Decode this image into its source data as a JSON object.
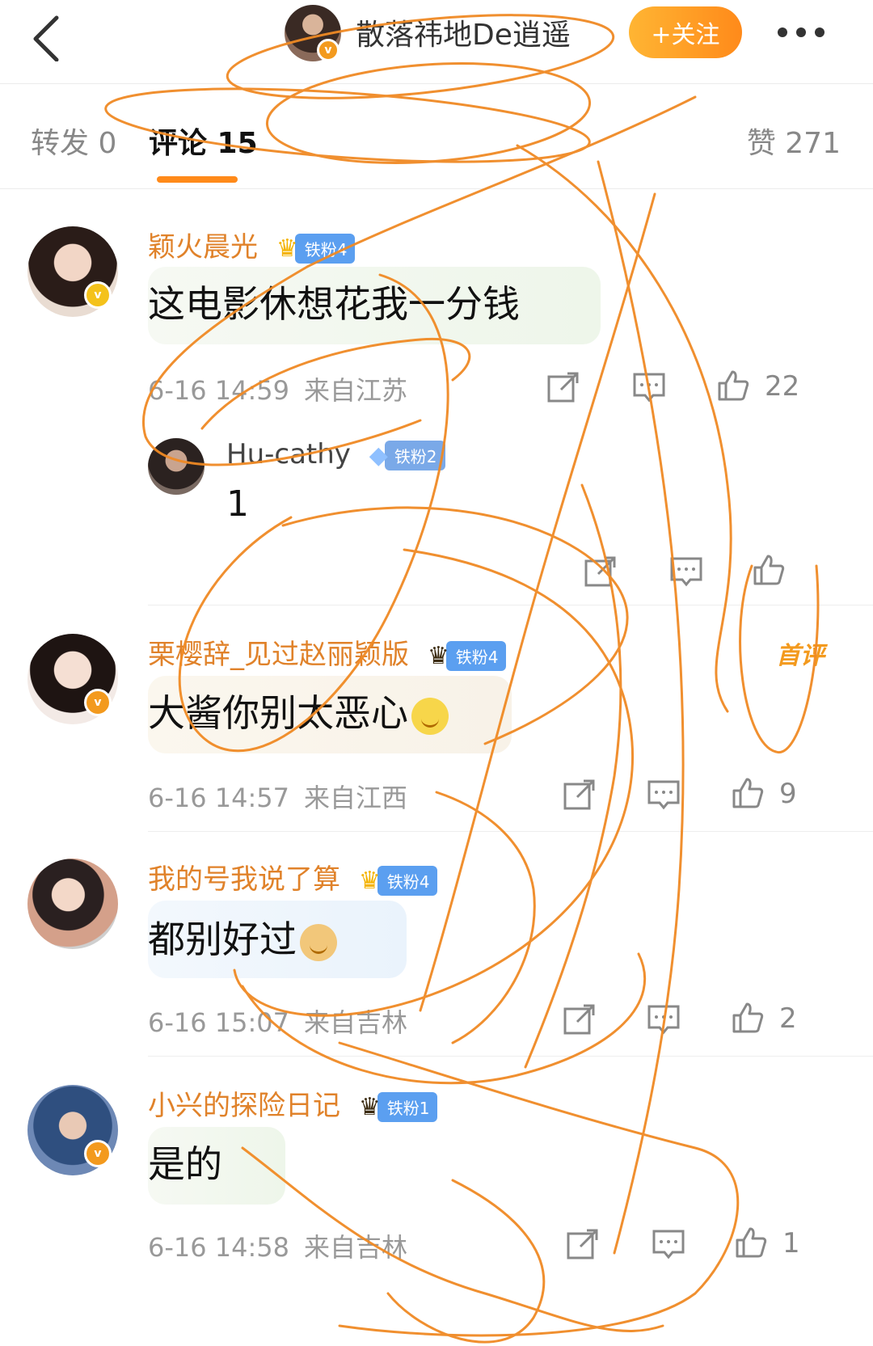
{
  "header": {
    "author_name": "散落祎地De逍遥",
    "follow_label": "+关注"
  },
  "tabs": {
    "repost": "转发 0",
    "comment": "评论 15",
    "like": "赞 271"
  },
  "comments": [
    {
      "user": "颖火晨光",
      "fan_badge": "铁粉4",
      "text": "这电影休想花我一分钱",
      "time": "6-16 14:59",
      "location": "来自江苏",
      "likes": "22",
      "reply": {
        "user": "Hu-cathy",
        "fan_badge": "铁粉2",
        "text": "1"
      }
    },
    {
      "user": "栗樱辞_见过赵丽颖版",
      "fan_badge": "铁粉4",
      "first_label": "首评",
      "text": "大酱你别太恶心",
      "time": "6-16 14:57",
      "location": "来自江西",
      "likes": "9"
    },
    {
      "user": "我的号我说了算",
      "fan_badge": "铁粉4",
      "text": "都别好过",
      "time": "6-16 15:07",
      "location": "来自吉林",
      "likes": "2"
    },
    {
      "user": "小兴的探险日记",
      "fan_badge": "铁粉1",
      "text": "是的",
      "time": "6-16 14:58",
      "location": "来自吉林",
      "likes": "1"
    }
  ],
  "colors": {
    "accent": "#ff8a1a",
    "username": "#e0822a",
    "fan_badge": "#5b9ff0",
    "scribble": "#f08a24"
  }
}
